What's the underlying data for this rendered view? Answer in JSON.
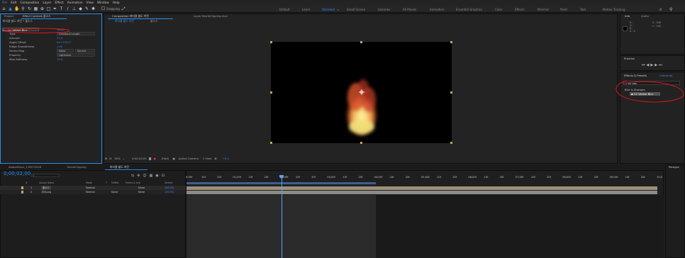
{
  "menu": [
    "File",
    "Edit",
    "Composition",
    "Layer",
    "Effect",
    "Animation",
    "View",
    "Window",
    "Help"
  ],
  "toolbar": {
    "snapping_label": "Snapping"
  },
  "workspaces": [
    "Default",
    "Learn",
    "Standard",
    "Small Screen",
    "Libraries",
    "All Panels",
    "Animation",
    "Essential Graphics",
    "Color",
    "Effects",
    "Minimal",
    "Paint",
    "Text",
    "Motion Tracking"
  ],
  "workspace_selected": "Standard",
  "effect_controls": {
    "tab_project": "Project",
    "tab_label": "Effect Controls 불소스",
    "header": "파티클 불도 허전 • 불소스",
    "effect_name": "CC Vector Blur",
    "reset": "Reset",
    "props": [
      {
        "name": "Type",
        "value": "Constant Length",
        "dropdown": true
      },
      {
        "name": "Amount",
        "value": "27.0"
      },
      {
        "name": "Angle Offset",
        "value": "0x+170.0°"
      },
      {
        "name": "Ridge Smoothness",
        "value": "1.00"
      },
      {
        "name": "Vector Map",
        "value": "None",
        "extra": "Source"
      },
      {
        "name": "Property",
        "value": "Lightness",
        "dropdown": true
      },
      {
        "name": "Map Softness",
        "value": "15.0"
      }
    ]
  },
  "composition": {
    "tab_label": "Composition 파티클 불도 허전",
    "breadcrumb": "파티클 불도 허전",
    "sub_breadcrumb": "불소스",
    "layer_tab": "Layer MovieClipping.mov",
    "footer": {
      "zoom": "50%",
      "timecode": "0;00;02;00",
      "quality": "(Half)",
      "camera": "Active Camera",
      "view": "1 View",
      "offset": "+0.0"
    }
  },
  "info_panel": {
    "tab_info": "Info",
    "tab_audio": "Audio",
    "rgb": [
      "R :",
      "G :",
      "B :",
      "A : 0"
    ],
    "xy": [
      "X : 906",
      "Y : 194"
    ]
  },
  "preview": {
    "title": "Preview"
  },
  "effects_presets": {
    "tab": "Effects & Presets",
    "tab2": "Character",
    "search": "cc vec",
    "category": "Blur & Sharpen",
    "result": "CC Vector Blur"
  },
  "bottom_tabs": [
    "AdobeStock_176570528",
    "MovieClipping",
    "파티클 불도 허전"
  ],
  "timeline": {
    "timecode": "0;00;02;00",
    "col_headers": [
      "#",
      "Source Name",
      "Mode",
      "T",
      "TrkMat",
      "Parent & Link",
      "Stretch"
    ],
    "layers": [
      {
        "num": "1",
        "name": "불소스",
        "mode": "Normal",
        "trkmat": "",
        "parent": "None",
        "stretch": "100.0%"
      },
      {
        "num": "2",
        "name": "사대.png",
        "mode": "Normal",
        "trkmat": "None",
        "parent": "None",
        "stretch": "100.0%"
      }
    ],
    "ruler": [
      "0;00f",
      "10f",
      "20f",
      "01;00f",
      "10f",
      "20f",
      "02;00f",
      "10f",
      "20f",
      "03;00f",
      "10f",
      "20f",
      "04;00f",
      "10f",
      "20f",
      "05;00f",
      "10f",
      "20f",
      "06;00f",
      "10f",
      "20f",
      "07;00f",
      "10f",
      "20f",
      "08;00f",
      "10f",
      "20f",
      "09;00f",
      "10f",
      "20f",
      "10;0"
    ]
  },
  "right_edge": {
    "paragraph": "Paragra"
  },
  "colors": {
    "accent": "#2d8ceb",
    "annotation": "#e0161c",
    "fire_core": "#f5e27a",
    "fire_outer": "#d8461c"
  }
}
